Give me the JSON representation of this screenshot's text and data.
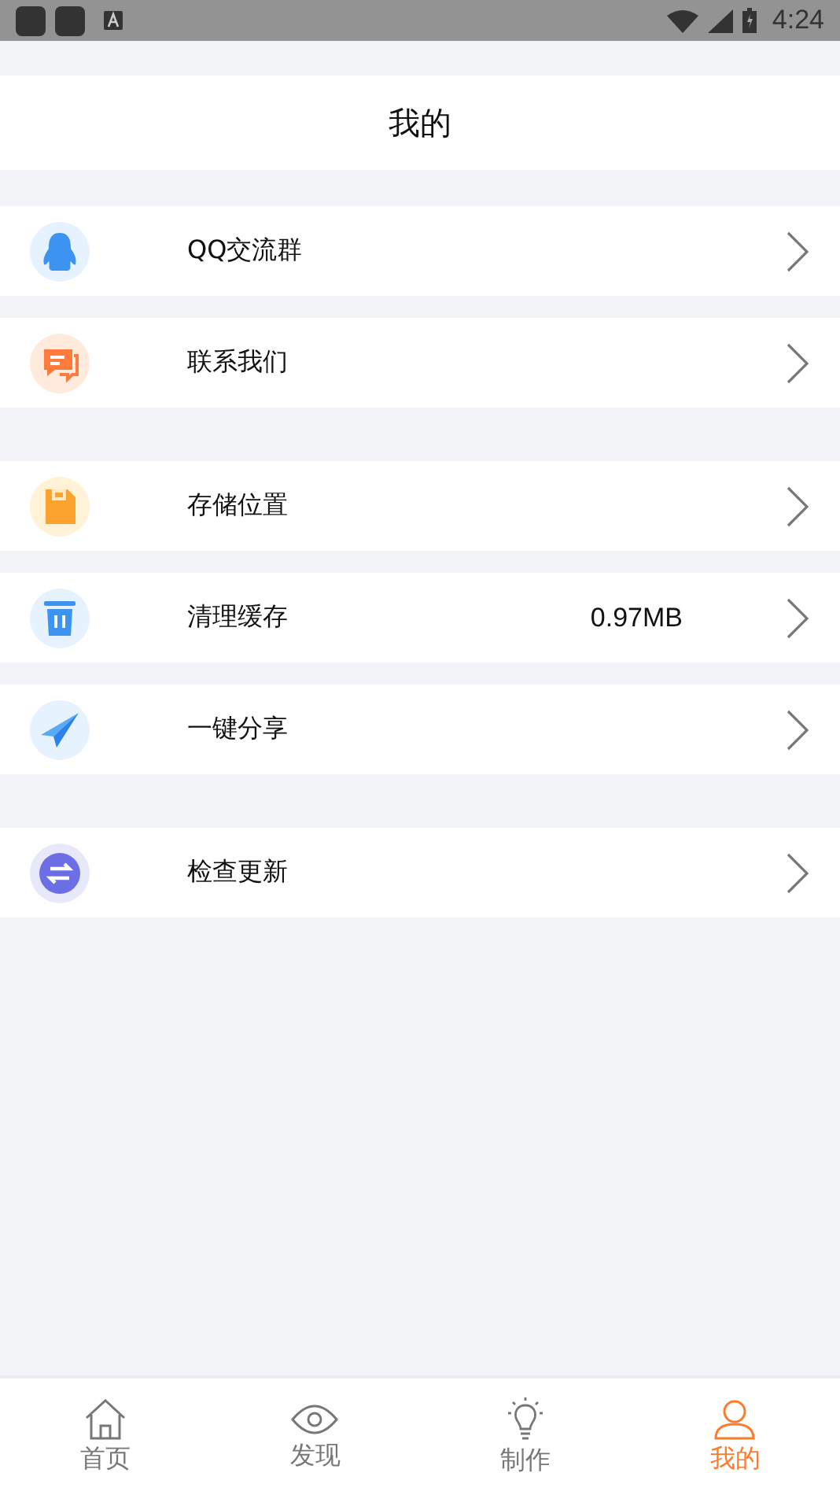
{
  "status_bar": {
    "time": "4:24"
  },
  "header": {
    "title": "我的"
  },
  "sections": [
    {
      "items": [
        {
          "label": "QQ交流群"
        },
        {
          "label": "联系我们"
        }
      ]
    },
    {
      "items": [
        {
          "label": "存储位置"
        },
        {
          "label": "清理缓存",
          "value": "0.97MB"
        },
        {
          "label": "一键分享"
        }
      ]
    },
    {
      "items": [
        {
          "label": "检查更新"
        }
      ]
    }
  ],
  "tabs": [
    {
      "label": "首页",
      "selected": false
    },
    {
      "label": "发现",
      "selected": false
    },
    {
      "label": "制作",
      "selected": false
    },
    {
      "label": "我的",
      "selected": true
    }
  ]
}
